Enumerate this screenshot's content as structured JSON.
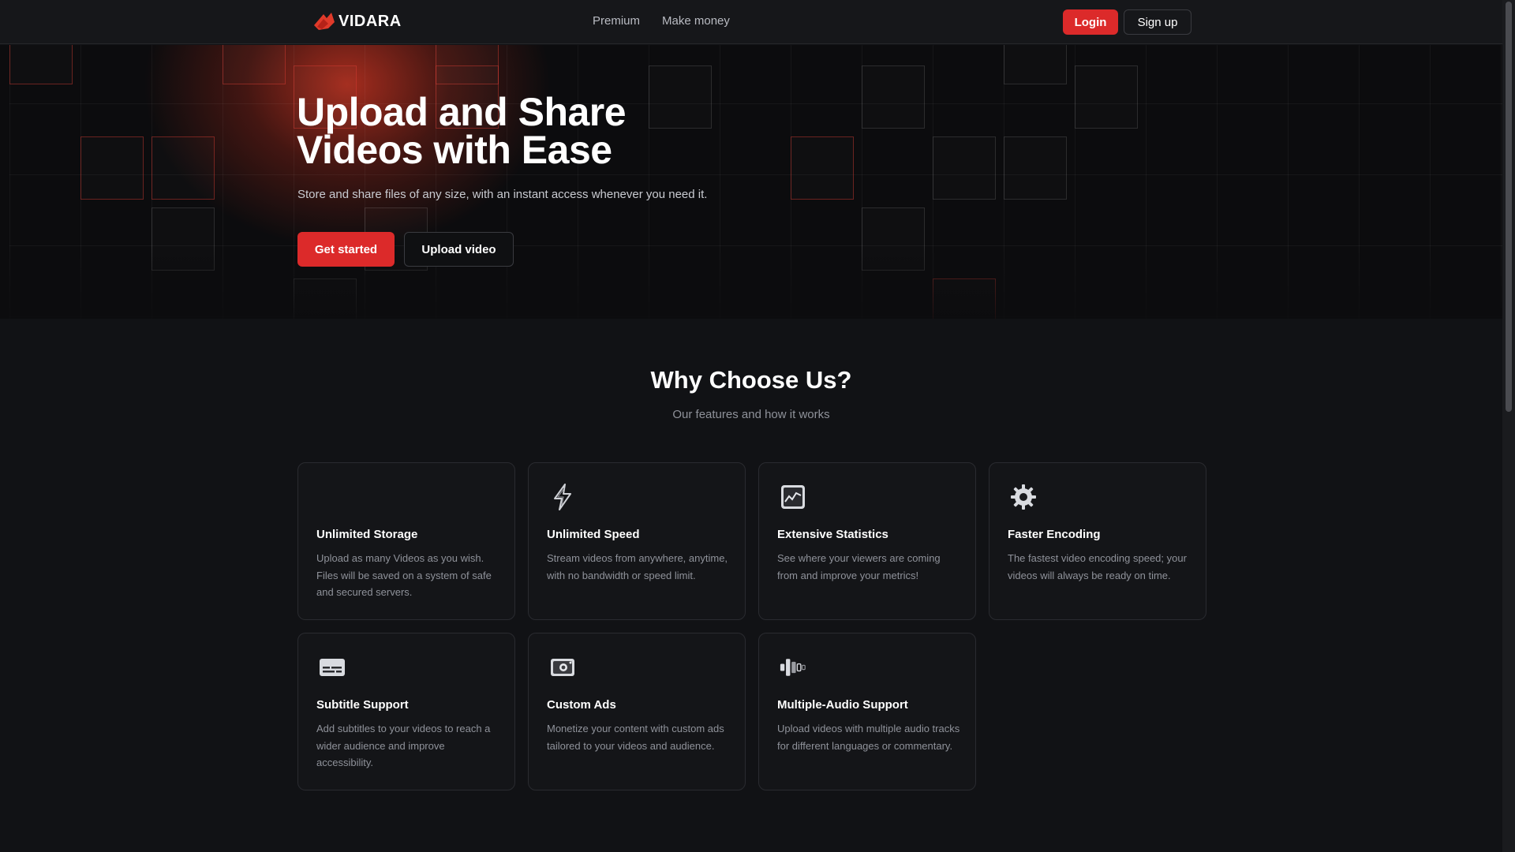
{
  "header": {
    "logo_text": "VIDARA",
    "nav": [
      "Premium",
      "Make money"
    ],
    "login_label": "Login",
    "signup_label": "Sign up"
  },
  "hero": {
    "title_line1": "Upload and Share",
    "title_line2": "Videos with Ease",
    "subtitle": "Store and share files of any size, with an instant access whenever you need it.",
    "get_started_label": "Get started",
    "upload_label": "Upload video"
  },
  "features": {
    "title": "Why Choose Us?",
    "subtitle": "Our features and how it works",
    "cards": [
      {
        "title": "Unlimited Storage",
        "desc": "Upload as many Videos as you wish. Files will be saved on a system of safe and secured servers.",
        "icon": "storage-icon"
      },
      {
        "title": "Unlimited Speed",
        "desc": "Stream videos from anywhere, anytime, with no bandwidth or speed limit.",
        "icon": "lightning-icon"
      },
      {
        "title": "Extensive Statistics",
        "desc": "See where your viewers are coming from and improve your metrics!",
        "icon": "chart-icon"
      },
      {
        "title": "Faster Encoding",
        "desc": "The fastest video encoding speed; your videos will always be ready on time.",
        "icon": "gear-icon"
      },
      {
        "title": "Subtitle Support",
        "desc": "Add subtitles to your videos to reach a wider audience and improve accessibility.",
        "icon": "subtitles-icon"
      },
      {
        "title": "Custom Ads",
        "desc": "Monetize your content with custom ads tailored to your videos and audience.",
        "icon": "ads-icon"
      },
      {
        "title": "Multiple-Audio Support",
        "desc": "Upload videos with multiple audio tracks for different languages or commentary.",
        "icon": "audio-icon"
      }
    ]
  },
  "colors": {
    "accent": "#dc2a2a",
    "background": "#111215",
    "card": "#141518",
    "muted_text": "#8f929a"
  }
}
